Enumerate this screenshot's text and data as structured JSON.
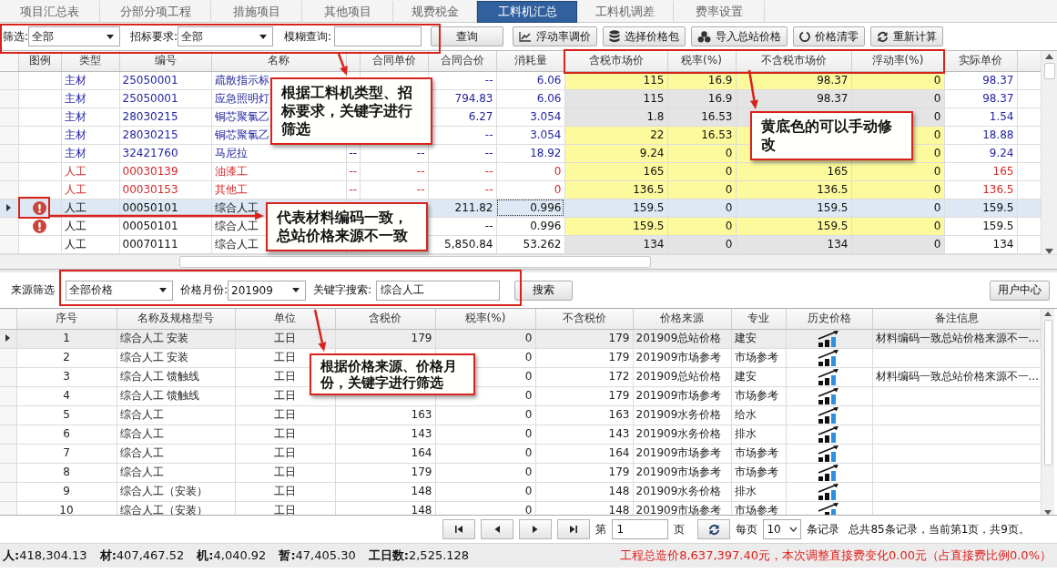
{
  "tabs": [
    {
      "label": "项目汇总表",
      "selected": false
    },
    {
      "label": "分部分项工程",
      "selected": false
    },
    {
      "label": "措施项目",
      "selected": false
    },
    {
      "label": "其他项目",
      "selected": false
    },
    {
      "label": "规费税金",
      "selected": false
    },
    {
      "label": "工料机汇总",
      "selected": true
    },
    {
      "label": "工料机调差",
      "selected": false
    },
    {
      "label": "费率设置",
      "selected": false
    }
  ],
  "filter_bar": {
    "filter_label": "筛选:",
    "filter_value": "全部",
    "bid_label": "招标要求:",
    "bid_value": "全部",
    "fuzzy_label": "模糊查询:",
    "query_button": "查询",
    "tools": [
      "浮动率调价",
      "选择价格包",
      "导入总站价格",
      "价格清零",
      "重新计算"
    ]
  },
  "material_table": {
    "columns": [
      "图例",
      "类型",
      "编号",
      "名称",
      "合同单价",
      "合同合价",
      "消耗量",
      "含税市场价",
      "税率(%)",
      "不含税市场价",
      "浮动率(%)",
      "实际单价"
    ],
    "rows": [
      {
        "warning": false,
        "selected": false,
        "editable": true,
        "color": "#2424a0",
        "type": "主材",
        "code": "25050001",
        "name": "疏散指示标",
        "contract_total": "--",
        "consumption": "6.06",
        "tax_market_price": "115",
        "tax_rate": "16.9",
        "net_market_price": "98.37",
        "float_rate": "0",
        "actual_price": "98.37"
      },
      {
        "warning": false,
        "selected": false,
        "editable": false,
        "color": "#2424a0",
        "type": "主材",
        "code": "25050001",
        "name": "应急照明灯",
        "contract_total": "794.83",
        "consumption": "6.06",
        "tax_market_price": "115",
        "tax_rate": "16.9",
        "net_market_price": "98.37",
        "float_rate": "0",
        "actual_price": "98.37"
      },
      {
        "warning": false,
        "selected": false,
        "editable": false,
        "color": "#2424a0",
        "type": "主材",
        "code": "28030215",
        "name": "铜芯聚氯乙",
        "contract_total": "6.27",
        "consumption": "3.054",
        "tax_market_price": "1.8",
        "tax_rate": "16.53",
        "float_rate": "0",
        "actual_price": "1.54"
      },
      {
        "warning": false,
        "selected": false,
        "editable": true,
        "color": "#2424a0",
        "type": "主材",
        "code": "28030215",
        "name": "铜芯聚氯乙",
        "contract_total": "--",
        "consumption": "3.054",
        "tax_market_price": "22",
        "tax_rate": "16.53",
        "float_rate": "0",
        "actual_price": "18.88"
      },
      {
        "warning": false,
        "selected": false,
        "editable": true,
        "color": "#2424a0",
        "type": "主材",
        "code": "32421760",
        "name": "马尼拉",
        "column_5": "--",
        "contract_unit_price": "--",
        "contract_total": "--",
        "consumption": "18.92",
        "tax_market_price": "9.24",
        "tax_rate": "0",
        "float_rate": "0",
        "actual_price": "9.24"
      },
      {
        "warning": false,
        "selected": false,
        "editable": true,
        "color": "#d42a2a",
        "type": "人工",
        "code": "00030139",
        "name": "油漆工",
        "column_5": "--",
        "contract_unit_price": "--",
        "contract_total": "--",
        "consumption": "0",
        "tax_market_price": "165",
        "tax_rate": "0",
        "net_market_price": "165",
        "float_rate": "0",
        "actual_price": "165"
      },
      {
        "warning": false,
        "selected": false,
        "editable": true,
        "color": "#d42a2a",
        "type": "人工",
        "code": "00030153",
        "name": "其他工",
        "column_5": "--",
        "contract_unit_price": "--",
        "contract_total": "--",
        "consumption": "0",
        "tax_market_price": "136.5",
        "tax_rate": "0",
        "net_market_price": "136.5",
        "float_rate": "0",
        "actual_price": "136.5"
      },
      {
        "warning": true,
        "selected": true,
        "editable": true,
        "type": "人工",
        "code": "00050101",
        "name": "综合人工",
        "contract_total": "211.82",
        "consumption": "0.996",
        "tax_market_price": "159.5",
        "tax_rate": "0",
        "net_market_price": "159.5",
        "float_rate": "0",
        "actual_price": "159.5"
      },
      {
        "warning": true,
        "selected": false,
        "editable": true,
        "type": "人工",
        "code": "00050101",
        "name": "综合人工",
        "contract_total": "--",
        "consumption": "0.996",
        "tax_market_price": "159.5",
        "tax_rate": "0",
        "net_market_price": "159.5",
        "float_rate": "0",
        "actual_price": "159.5"
      },
      {
        "warning": false,
        "selected": false,
        "editable": false,
        "type": "人工",
        "code": "00070111",
        "name": "综合人工",
        "contract_total": "5,850.84",
        "consumption": "53.262",
        "tax_market_price": "134",
        "tax_rate": "0",
        "net_market_price": "134",
        "float_rate": "0",
        "actual_price": "134"
      }
    ]
  },
  "price_filter": {
    "source_label": "来源筛选",
    "source_value": "全部价格",
    "month_label": "价格月份:",
    "month_value": "201909",
    "keyword_label": "关键字搜索:",
    "keyword_value": "综合人工",
    "search_button": "搜索",
    "user_center_button": "用户中心"
  },
  "price_table": {
    "columns": [
      "序号",
      "名称及规格型号",
      "单位",
      "含税价",
      "税率(%)",
      "不含税价",
      "价格来源",
      "专业",
      "历史价格",
      "备注信息"
    ],
    "rows": [
      {
        "selected": true,
        "index": "1",
        "name": "综合人工 安装",
        "unit": "工日",
        "tax_price": "179",
        "tax_rate": "0",
        "net_price": "179",
        "source": "201909总站价格",
        "specialty": "建安",
        "remark": "材料编码一致总站价格来源不一..."
      },
      {
        "selected": false,
        "index": "2",
        "name": "综合人工 安装",
        "unit": "工日",
        "tax_rate": "0",
        "net_price": "179",
        "source": "201909市场参考",
        "specialty": "市场参考"
      },
      {
        "selected": false,
        "index": "3",
        "name": "综合人工 馈触线",
        "unit": "工日",
        "tax_rate": "0",
        "net_price": "172",
        "source": "201909总站价格",
        "specialty": "建安",
        "remark": "材料编码一致总站价格来源不一..."
      },
      {
        "selected": false,
        "index": "4",
        "name": "综合人工 馈触线",
        "unit": "工日",
        "tax_rate": "0",
        "net_price": "179",
        "source": "201909市场参考",
        "specialty": "市场参考"
      },
      {
        "selected": false,
        "index": "5",
        "name": "综合人工",
        "unit": "工日",
        "tax_price": "163",
        "tax_rate": "0",
        "net_price": "163",
        "source": "201909水务价格",
        "specialty": "给水"
      },
      {
        "selected": false,
        "index": "6",
        "name": "综合人工",
        "unit": "工日",
        "tax_price": "143",
        "tax_rate": "0",
        "net_price": "143",
        "source": "201909水务价格",
        "specialty": "排水"
      },
      {
        "selected": false,
        "index": "7",
        "name": "综合人工",
        "unit": "工日",
        "tax_price": "164",
        "tax_rate": "0",
        "net_price": "164",
        "source": "201909市场参考",
        "specialty": "市场参考"
      },
      {
        "selected": false,
        "index": "8",
        "name": "综合人工",
        "unit": "工日",
        "tax_price": "179",
        "tax_rate": "0",
        "net_price": "179",
        "source": "201909市场参考",
        "specialty": "市场参考"
      },
      {
        "selected": false,
        "index": "9",
        "name": "综合人工（安装）",
        "unit": "工日",
        "tax_price": "148",
        "tax_rate": "0",
        "net_price": "148",
        "source": "201909水务价格",
        "specialty": "排水"
      },
      {
        "selected": false,
        "index": "10",
        "name": "综合人工（安装）",
        "unit": "工日",
        "tax_price": "148",
        "tax_rate": "0",
        "net_price": "148",
        "source": "201909市场参考",
        "specialty": "市场参考"
      }
    ]
  },
  "pager": {
    "page_prefix": "第",
    "page_value": "1",
    "page_suffix": "页",
    "per_page_label": "每页",
    "per_page_value": "10",
    "records_label": "条记录",
    "summary": "总共85条记录，当前第1页，共9页。"
  },
  "status_bar": {
    "items": [
      {
        "label": "人:",
        "value": "418,304.13"
      },
      {
        "label": "材:",
        "value": "407,467.52"
      },
      {
        "label": "机:",
        "value": "4,040.92"
      },
      {
        "label": "暂:",
        "value": "47,405.30"
      },
      {
        "label": "工日数:",
        "value": "2,525.128"
      }
    ],
    "total": "工程总造价8,637,397.40元，本次调整直接费变化0.00元（占直接费比例0.0%）"
  },
  "annotations": [
    {
      "kind": "callout",
      "text": "根据工料机类型、招标要求，关键字进行筛选"
    },
    {
      "kind": "callout",
      "text": "黄底色的可以手动修改"
    },
    {
      "kind": "callout",
      "text": "代表材料编码一致，总站价格来源不一致"
    },
    {
      "kind": "callout",
      "text": "根据价格来源、价格月份，关键字进行筛选"
    }
  ]
}
